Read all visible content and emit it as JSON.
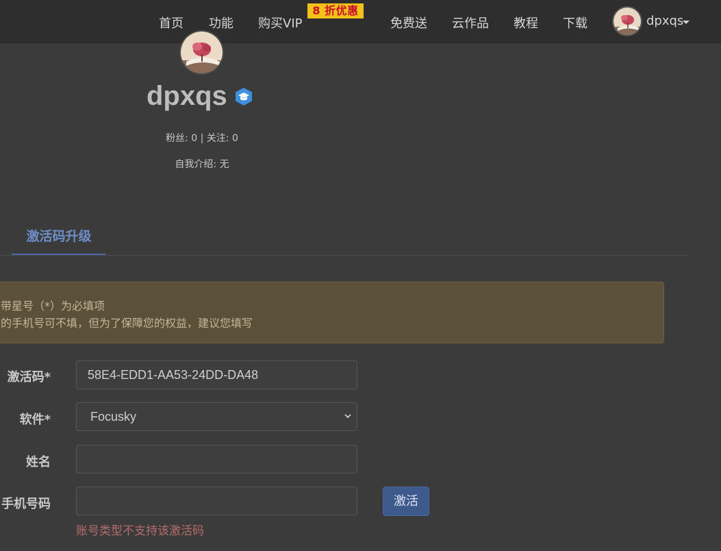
{
  "nav": {
    "items": [
      "首页",
      "功能",
      "购买VIP",
      "免费送",
      "云作品",
      "教程",
      "下载"
    ],
    "vip_badge": "8 折优惠",
    "username": "dpxqs"
  },
  "profile": {
    "name": "dpxqs",
    "stats": "粉丝: 0 | 关注: 0",
    "bio": "自我介绍: 无"
  },
  "tab": {
    "label": "激活码升级"
  },
  "alert": {
    "line1": "带星号（*）为必填项",
    "line2": "的手机号可不填，但为了保障您的权益，建议您填写"
  },
  "form": {
    "code_label": "激活码*",
    "code_value": "58E4-EDD1-AA53-24DD-DA48",
    "software_label": "软件*",
    "software_value": "Focusky",
    "name_label": "姓名",
    "name_value": "",
    "phone_label": "手机号码",
    "phone_value": "",
    "submit_label": "激活",
    "error": "账号类型不支持该激活码"
  },
  "colors": {
    "background": "#3b3b3b",
    "topbar": "#2e2e2e",
    "accent": "#4a6aa8",
    "badge": "#f2c21b",
    "error": "#b86c6c"
  }
}
